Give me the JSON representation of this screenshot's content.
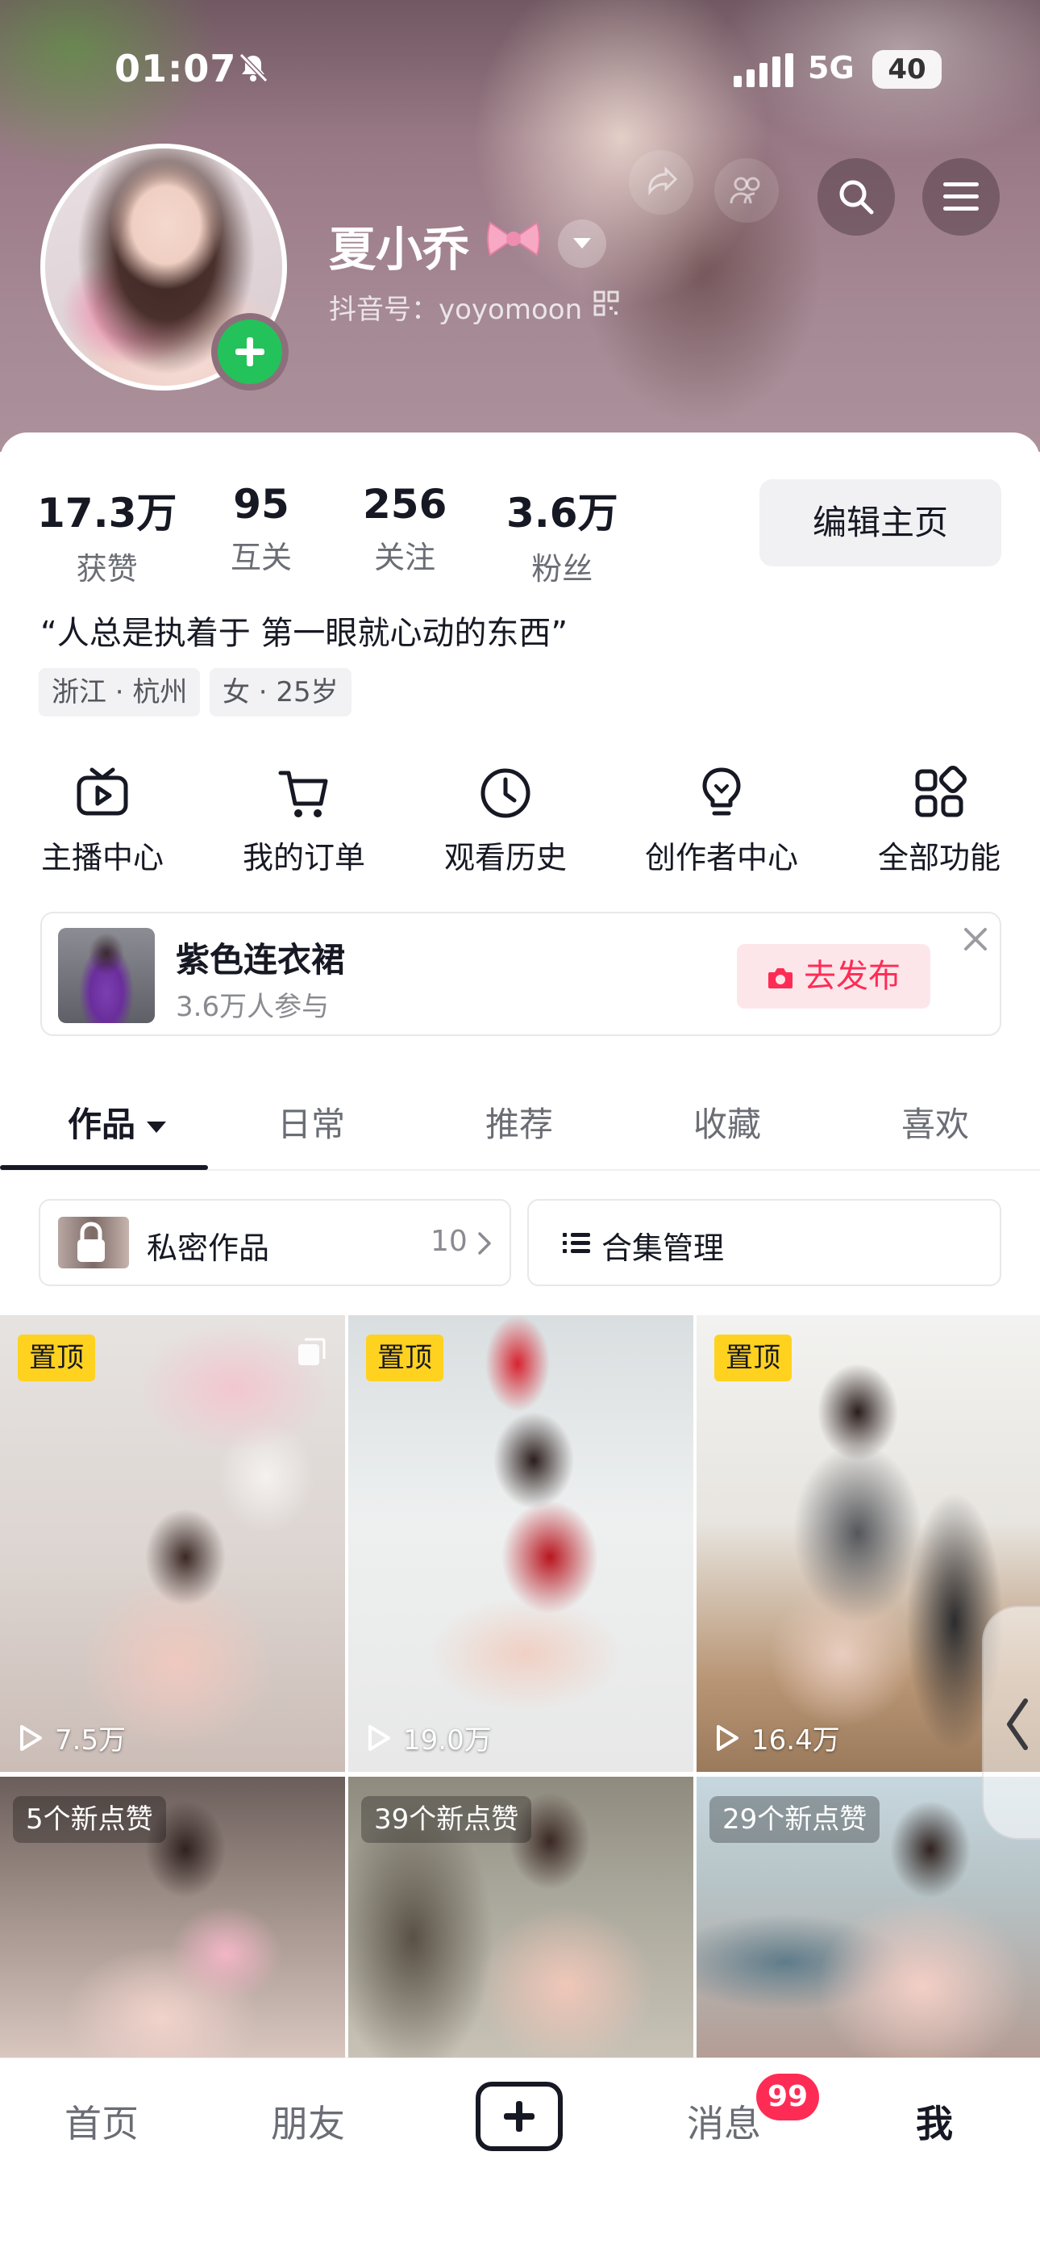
{
  "status_bar": {
    "time": "01:07",
    "network": "5G",
    "battery": "40"
  },
  "profile": {
    "nickname": "夏小乔",
    "douyin_id": "抖音号：yoyomoon",
    "stats": [
      {
        "value": "17.3万",
        "label": "获赞"
      },
      {
        "value": "95",
        "label": "互关"
      },
      {
        "value": "256",
        "label": "关注"
      },
      {
        "value": "3.6万",
        "label": "粉丝"
      }
    ],
    "edit_label": "编辑主页",
    "bio": "“人总是执着于 第一眼就心动的东西”",
    "tags": [
      "浙江 · 杭州",
      "女 · 25岁"
    ]
  },
  "features": [
    {
      "label": "主播中心",
      "icon": "tv-icon"
    },
    {
      "label": "我的订单",
      "icon": "cart-icon"
    },
    {
      "label": "观看历史",
      "icon": "clock-icon"
    },
    {
      "label": "创作者中心",
      "icon": "lightbulb-icon"
    },
    {
      "label": "全部功能",
      "icon": "apps-icon"
    }
  ],
  "challenge": {
    "title": "紫色连衣裙",
    "participants": "3.6万人参与",
    "action": "去发布"
  },
  "tabs": [
    "作品",
    "日常",
    "推荐",
    "收藏",
    "喜欢"
  ],
  "tools": {
    "private_label": "私密作品",
    "private_count": "10",
    "collection_label": "合集管理"
  },
  "grid": {
    "pin_label": "置顶",
    "row1": [
      {
        "plays": "7.5万"
      },
      {
        "plays": "19.0万"
      },
      {
        "plays": "16.4万"
      }
    ],
    "row2": [
      {
        "likes": "5个新点赞"
      },
      {
        "likes": "39个新点赞"
      },
      {
        "likes": "29个新点赞"
      }
    ]
  },
  "bottom_nav": {
    "home": "首页",
    "friends": "朋友",
    "messages": "消息",
    "messages_badge": "99",
    "me": "我"
  }
}
